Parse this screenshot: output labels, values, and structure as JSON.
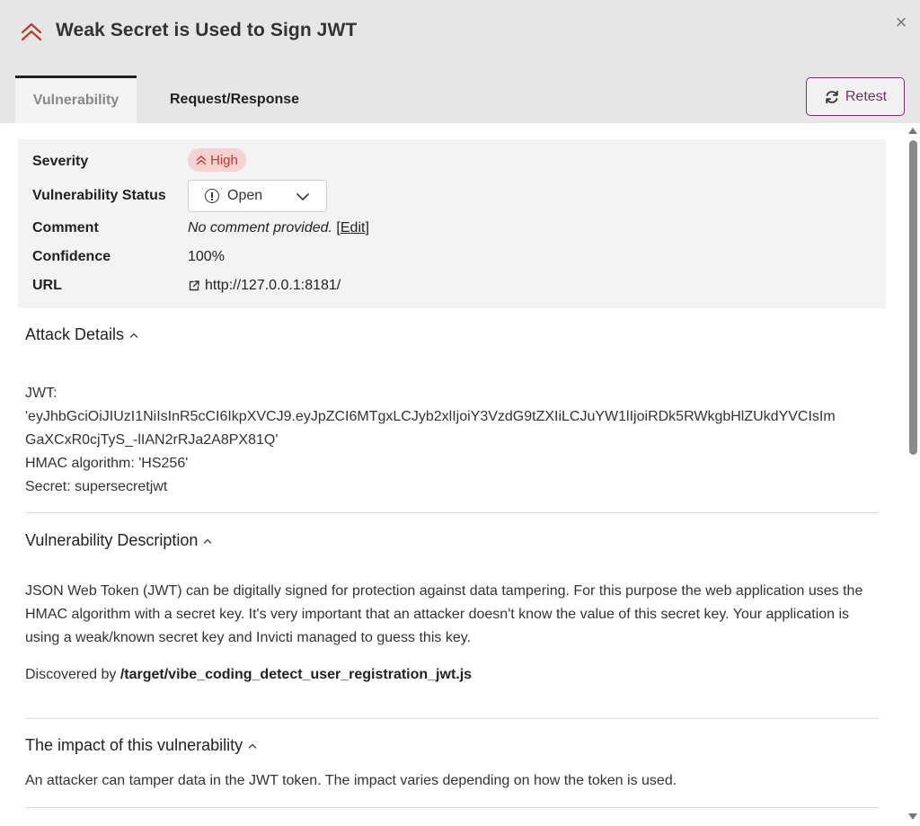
{
  "header": {
    "title": "Weak Secret is Used to Sign JWT",
    "close_label": "×"
  },
  "tabs": [
    {
      "label": "Vulnerability",
      "active": true
    },
    {
      "label": "Request/Response",
      "active": false
    }
  ],
  "retest_label": "Retest",
  "summary": {
    "severity_label": "Severity",
    "severity_value": "High",
    "status_label": "Vulnerability Status",
    "status_value": "Open",
    "comment_label": "Comment",
    "comment_value": "No comment provided.",
    "comment_edit": "Edit",
    "confidence_label": "Confidence",
    "confidence_value": "100%",
    "url_label": "URL",
    "url_value": "http://127.0.0.1:8181/"
  },
  "attack_details": {
    "title": "Attack Details",
    "jwt_label": "JWT:",
    "jwt_line1": "'eyJhbGciOiJIUzI1NiIsInR5cCI6IkpXVCJ9.eyJpZCI6MTgxLCJyb2xlIjoiY3VzdG9tZXIiLCJuYW1lIjoiRDk5RWkgbHlZUkdYVCIsIm",
    "jwt_line2": "GaXCxR0cjTyS_-lIAN2rRJa2A8PX81Q'",
    "hmac": "HMAC algorithm: 'HS256'",
    "secret": "Secret: supersecretjwt"
  },
  "vulnerability_description": {
    "title": "Vulnerability Description",
    "text": "JSON Web Token (JWT) can be digitally signed for protection against data tampering. For this purpose the web application uses the HMAC algorithm with a secret key. It's very important that an attacker doesn't know the value of this secret key. Your application is using a weak/known secret key and Invicti managed to guess this key.",
    "discovered_prefix": "Discovered by",
    "discovered_by": "/target/vibe_coding_detect_user_registration_jwt.js"
  },
  "impact": {
    "title": "The impact of this vulnerability",
    "text": "An attacker can tamper data in the JWT token. The impact varies depending on how the token is used."
  },
  "colors": {
    "header_bg": "#e6e6e6",
    "severity_high": "#c0392b",
    "severity_badge_bg": "#f6d2d2",
    "accent_purple": "#7a2e6f"
  }
}
